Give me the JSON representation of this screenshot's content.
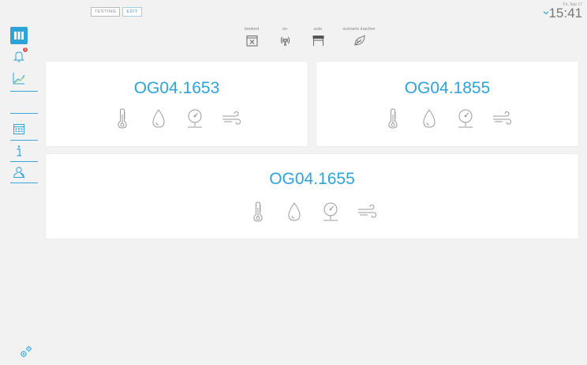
{
  "topbar": {
    "tags": [
      "TESTING",
      "EDIT"
    ],
    "date": "Fri, Sep 17",
    "time": "15:41"
  },
  "status_items": [
    {
      "label": "booked",
      "icon": "calendar-x-icon"
    },
    {
      "label": "on",
      "icon": "broadcast-icon"
    },
    {
      "label": "auto",
      "icon": "blinds-icon"
    },
    {
      "label": "scenario inactive",
      "icon": "scenario-icon"
    }
  ],
  "sidebar": {
    "items": [
      {
        "name": "rooms",
        "icon": "grid-icon",
        "active": true
      },
      {
        "name": "notifications",
        "icon": "bell-icon",
        "badge": "1"
      },
      {
        "name": "charts",
        "icon": "line-chart-icon"
      },
      {
        "name": "calendar",
        "icon": "calendar-icon"
      },
      {
        "name": "info",
        "icon": "info-icon"
      },
      {
        "name": "user",
        "icon": "user-icon"
      },
      {
        "name": "settings",
        "icon": "gears-icon"
      }
    ]
  },
  "rooms": [
    {
      "name": "OG04.1653",
      "sensors": [
        "thermometer-icon",
        "humidity-icon",
        "pressure-icon",
        "wind-icon"
      ]
    },
    {
      "name": "OG04.1855",
      "sensors": [
        "thermometer-icon",
        "humidity-icon",
        "pressure-icon",
        "wind-icon"
      ]
    },
    {
      "name": "OG04.1655",
      "sensors": [
        "thermometer-icon",
        "humidity-icon",
        "pressure-icon",
        "wind-icon"
      ]
    }
  ],
  "colors": {
    "accent": "#2ea3d8",
    "icon_grey": "#9a9a9a",
    "alert": "#e04a4a"
  }
}
